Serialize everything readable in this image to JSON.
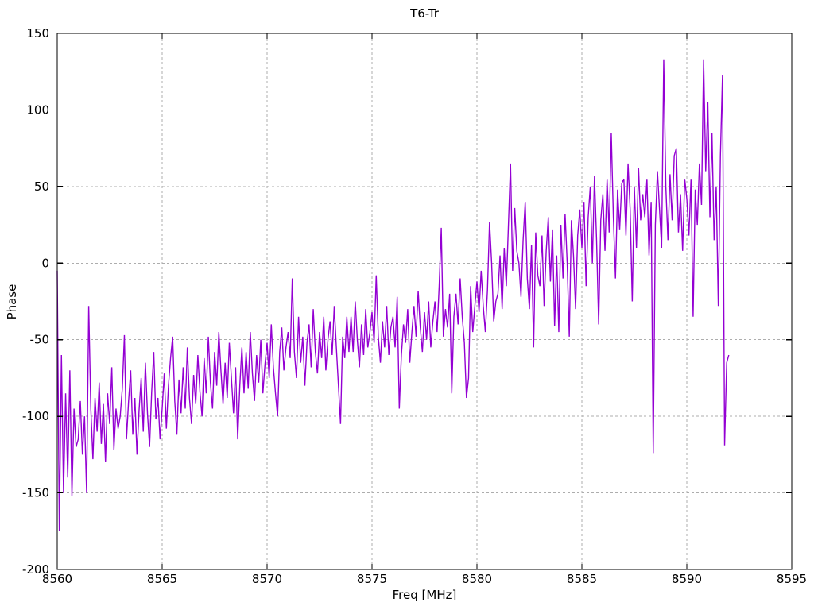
{
  "chart_data": {
    "type": "line",
    "title": "T6-Tr",
    "xlabel": "Freq [MHz]",
    "ylabel": "Phase",
    "xlim": [
      8560,
      8595
    ],
    "ylim": [
      -200,
      150
    ],
    "xticks": [
      8560,
      8565,
      8570,
      8575,
      8580,
      8585,
      8590,
      8595
    ],
    "yticks": [
      -200,
      -150,
      -100,
      -50,
      0,
      50,
      100,
      150
    ],
    "grid": true,
    "legend_position": "none",
    "line_color": "#9400d3",
    "grid_color": "#adadad",
    "axis_color": "#000000",
    "series": [
      {
        "x_start": 8560.0,
        "x_step": 0.1,
        "values": [
          -5,
          -175,
          -60,
          -150,
          -85,
          -140,
          -70,
          -152,
          -95,
          -120,
          -115,
          -90,
          -125,
          -100,
          -150,
          -28,
          -95,
          -128,
          -88,
          -110,
          -78,
          -118,
          -92,
          -130,
          -85,
          -105,
          -68,
          -122,
          -95,
          -108,
          -100,
          -82,
          -47,
          -115,
          -90,
          -70,
          -112,
          -88,
          -125,
          -96,
          -75,
          -110,
          -65,
          -98,
          -120,
          -84,
          -58,
          -102,
          -88,
          -115,
          -95,
          -72,
          -108,
          -80,
          -62,
          -48,
          -90,
          -112,
          -76,
          -98,
          -68,
          -95,
          -55,
          -88,
          -105,
          -73,
          -92,
          -60,
          -84,
          -100,
          -62,
          -85,
          -48,
          -78,
          -95,
          -58,
          -80,
          -45,
          -70,
          -92,
          -65,
          -88,
          -52,
          -75,
          -98,
          -68,
          -115,
          -80,
          -55,
          -85,
          -58,
          -82,
          -45,
          -72,
          -90,
          -60,
          -78,
          -50,
          -85,
          -66,
          -52,
          -75,
          -40,
          -68,
          -85,
          -100,
          -58,
          -42,
          -70,
          -55,
          -45,
          -62,
          -10,
          -58,
          -75,
          -35,
          -65,
          -48,
          -80,
          -52,
          -40,
          -68,
          -30,
          -58,
          -72,
          -45,
          -62,
          -35,
          -70,
          -50,
          -38,
          -60,
          -28,
          -55,
          -80,
          -105,
          -48,
          -62,
          -35,
          -58,
          -35,
          -58,
          -25,
          -50,
          -68,
          -40,
          -60,
          -30,
          -55,
          -45,
          -32,
          -52,
          -8,
          -48,
          -65,
          -38,
          -55,
          -28,
          -60,
          -42,
          -35,
          -55,
          -22,
          -95,
          -60,
          -40,
          -52,
          -30,
          -65,
          -45,
          -28,
          -48,
          -18,
          -42,
          -58,
          -32,
          -50,
          -25,
          -55,
          -38,
          -25,
          -45,
          -15,
          23,
          -48,
          -30,
          -42,
          -20,
          -85,
          -35,
          -20,
          -40,
          -10,
          -35,
          -52,
          -88,
          -75,
          -15,
          -45,
          -28,
          -12,
          -32,
          -5,
          -28,
          -45,
          -18,
          27,
          0,
          -38,
          -25,
          -20,
          5,
          -30,
          10,
          -15,
          25,
          65,
          -5,
          36,
          8,
          0,
          -22,
          15,
          40,
          -10,
          -30,
          12,
          -55,
          20,
          -8,
          -15,
          18,
          -28,
          8,
          30,
          -12,
          22,
          -41,
          5,
          -45,
          25,
          -10,
          32,
          0,
          -48,
          28,
          5,
          -30,
          18,
          35,
          10,
          40,
          -15,
          30,
          50,
          0,
          57,
          15,
          -40,
          28,
          45,
          8,
          55,
          20,
          85,
          30,
          -10,
          48,
          22,
          52,
          55,
          18,
          65,
          35,
          -25,
          50,
          10,
          62,
          28,
          45,
          30,
          55,
          5,
          40,
          -124,
          25,
          60,
          35,
          10,
          133,
          50,
          15,
          58,
          28,
          70,
          75,
          20,
          45,
          8,
          55,
          42,
          18,
          55,
          -35,
          48,
          25,
          65,
          38,
          133,
          60,
          105,
          30,
          85,
          15,
          50,
          -28,
          70,
          123,
          -119,
          -65,
          -60
        ]
      }
    ]
  }
}
